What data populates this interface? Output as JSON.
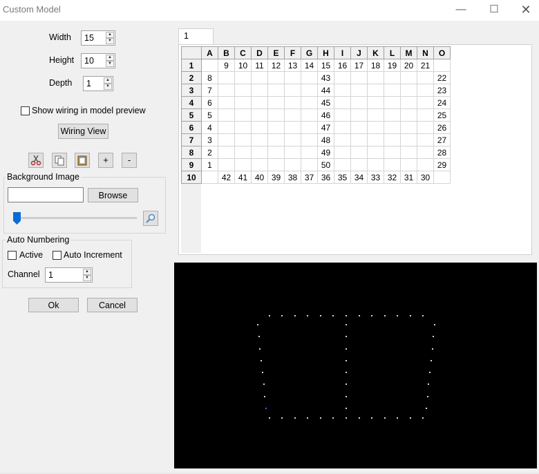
{
  "window": {
    "title": "Custom Model",
    "minimize_glyph": "—",
    "maximize_glyph": "☐",
    "close_glyph": "✕"
  },
  "fields": {
    "width_label": "Width",
    "width_value": "15",
    "height_label": "Height",
    "height_value": "10",
    "depth_label": "Depth",
    "depth_value": "1"
  },
  "show_wiring": {
    "label": "Show wiring in model preview",
    "checked": false
  },
  "wiring_view_button": "Wiring View",
  "toolbar": {
    "cut_icon": "scissors-icon",
    "copy_icon": "copy-icon",
    "paste_icon": "clipboard-icon",
    "add_label": "+",
    "remove_label": "-"
  },
  "background_image": {
    "group_label": "Background Image",
    "path_value": "",
    "browse_label": "Browse",
    "brightness_slider": 0,
    "zoom_icon": "magnifier-icon"
  },
  "auto_numbering": {
    "group_label": "Auto Numbering",
    "active_label": "Active",
    "active_checked": false,
    "auto_increment_label": "Auto Increment",
    "auto_increment_checked": false,
    "channel_label": "Channel",
    "channel_value": "1"
  },
  "dialog_buttons": {
    "ok": "Ok",
    "cancel": "Cancel"
  },
  "layer_tab": "1",
  "grid": {
    "columns": [
      "A",
      "B",
      "C",
      "D",
      "E",
      "F",
      "G",
      "H",
      "I",
      "J",
      "K",
      "L",
      "M",
      "N",
      "O"
    ],
    "rows": [
      {
        "label": "1",
        "cells": [
          "",
          "9",
          "10",
          "11",
          "12",
          "13",
          "14",
          "15",
          "16",
          "17",
          "18",
          "19",
          "20",
          "21",
          ""
        ]
      },
      {
        "label": "2",
        "cells": [
          "8",
          "",
          "",
          "",
          "",
          "",
          "",
          "43",
          "",
          "",
          "",
          "",
          "",
          "",
          "22"
        ]
      },
      {
        "label": "3",
        "cells": [
          "7",
          "",
          "",
          "",
          "",
          "",
          "",
          "44",
          "",
          "",
          "",
          "",
          "",
          "",
          "23"
        ]
      },
      {
        "label": "4",
        "cells": [
          "6",
          "",
          "",
          "",
          "",
          "",
          "",
          "45",
          "",
          "",
          "",
          "",
          "",
          "",
          "24"
        ]
      },
      {
        "label": "5",
        "cells": [
          "5",
          "",
          "",
          "",
          "",
          "",
          "",
          "46",
          "",
          "",
          "",
          "",
          "",
          "",
          "25"
        ]
      },
      {
        "label": "6",
        "cells": [
          "4",
          "",
          "",
          "",
          "",
          "",
          "",
          "47",
          "",
          "",
          "",
          "",
          "",
          "",
          "26"
        ]
      },
      {
        "label": "7",
        "cells": [
          "3",
          "",
          "",
          "",
          "",
          "",
          "",
          "48",
          "",
          "",
          "",
          "",
          "",
          "",
          "27"
        ]
      },
      {
        "label": "8",
        "cells": [
          "2",
          "",
          "",
          "",
          "",
          "",
          "",
          "49",
          "",
          "",
          "",
          "",
          "",
          "",
          "28"
        ]
      },
      {
        "label": "9",
        "cells": [
          "1",
          "",
          "",
          "",
          "",
          "",
          "",
          "50",
          "",
          "",
          "",
          "",
          "",
          "",
          "29"
        ]
      },
      {
        "label": "10",
        "cells": [
          "",
          "42",
          "41",
          "40",
          "39",
          "38",
          "37",
          "36",
          "35",
          "34",
          "33",
          "32",
          "31",
          "30",
          ""
        ]
      }
    ]
  },
  "colors": {
    "preview_background": "#000000",
    "node": "#d8d8d8",
    "start_node": "#3a6ad8",
    "slider_thumb": "#0a6cd6"
  }
}
